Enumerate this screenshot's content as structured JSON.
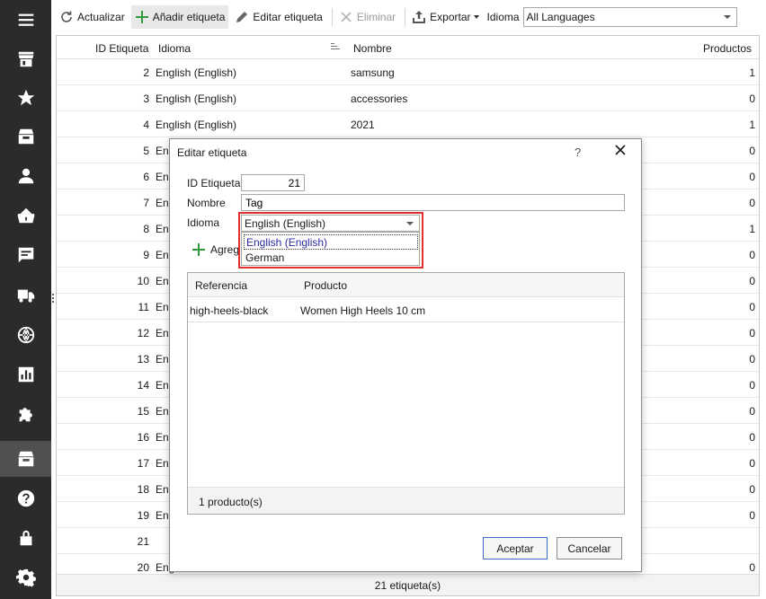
{
  "sidebar": {
    "items": [
      {
        "icon": "menu-icon",
        "active": false
      },
      {
        "icon": "store-icon",
        "active": false
      },
      {
        "icon": "star-icon",
        "active": false
      },
      {
        "icon": "inbox-icon",
        "active": false
      },
      {
        "icon": "user-icon",
        "active": false
      },
      {
        "icon": "basket-icon",
        "active": false
      },
      {
        "icon": "message-icon",
        "active": false
      },
      {
        "icon": "truck-icon",
        "active": false
      },
      {
        "icon": "globe-icon",
        "active": false
      },
      {
        "icon": "chart-icon",
        "active": false
      },
      {
        "icon": "puzzle-icon",
        "active": false
      },
      {
        "icon": "tag-box-icon",
        "active": true
      },
      {
        "icon": "help-icon",
        "active": false
      },
      {
        "icon": "lock-icon",
        "active": false
      },
      {
        "icon": "gear-icon",
        "active": false
      }
    ]
  },
  "toolbar": {
    "refresh_label": "Actualizar",
    "add_label": "Añadir etiqueta",
    "edit_label": "Editar etiqueta",
    "delete_label": "Eliminar",
    "export_label": "Exportar",
    "language_label": "Idioma",
    "language_value": "All Languages"
  },
  "grid": {
    "columns": {
      "id": "ID Etiqueta",
      "language": "Idioma",
      "name": "Nombre",
      "products": "Productos"
    },
    "rows": [
      {
        "id": "2",
        "language": "English (English)",
        "name": "samsung",
        "products": "1"
      },
      {
        "id": "3",
        "language": "English (English)",
        "name": "accessories",
        "products": "0"
      },
      {
        "id": "4",
        "language": "English (English)",
        "name": "2021",
        "products": "1"
      },
      {
        "id": "5",
        "language": "Eng",
        "name": "",
        "products": "0"
      },
      {
        "id": "6",
        "language": "Eng",
        "name": "",
        "products": "0"
      },
      {
        "id": "7",
        "language": "Eng",
        "name": "",
        "products": "0"
      },
      {
        "id": "8",
        "language": "Eng",
        "name": "",
        "products": "1"
      },
      {
        "id": "9",
        "language": "Eng",
        "name": "",
        "products": "0"
      },
      {
        "id": "10",
        "language": "Eng",
        "name": "",
        "products": "0"
      },
      {
        "id": "11",
        "language": "Eng",
        "name": "",
        "products": "0"
      },
      {
        "id": "12",
        "language": "Eng",
        "name": "",
        "products": "0"
      },
      {
        "id": "13",
        "language": "Eng",
        "name": "",
        "products": "0"
      },
      {
        "id": "14",
        "language": "Eng",
        "name": "",
        "products": "0"
      },
      {
        "id": "15",
        "language": "Eng",
        "name": "",
        "products": "0"
      },
      {
        "id": "16",
        "language": "Eng",
        "name": "",
        "products": "0"
      },
      {
        "id": "17",
        "language": "Eng",
        "name": "",
        "products": "0"
      },
      {
        "id": "18",
        "language": "Eng",
        "name": "",
        "products": "0"
      },
      {
        "id": "19",
        "language": "Eng",
        "name": "",
        "products": "0"
      },
      {
        "id": "21",
        "language": "",
        "name": "",
        "products": ""
      },
      {
        "id": "20",
        "language": "Eng",
        "name": "",
        "products": "0"
      }
    ],
    "footer": "21 etiqueta(s)"
  },
  "dialog": {
    "title": "Editar etiqueta",
    "help": "?",
    "id_label": "ID Etiqueta",
    "id_value": "21",
    "name_label": "Nombre",
    "name_value": "Tag",
    "language_label": "Idioma",
    "language_value": "English (English)",
    "language_options": [
      "English (English)",
      "German"
    ],
    "add_label": "Agreg",
    "products_table": {
      "columns": {
        "reference": "Referencia",
        "product": "Producto"
      },
      "rows": [
        {
          "reference": "high-heels-black",
          "product": "Women High Heels 10 cm"
        }
      ],
      "footer": "1 producto(s)"
    },
    "accept_label": "Aceptar",
    "cancel_label": "Cancelar"
  }
}
